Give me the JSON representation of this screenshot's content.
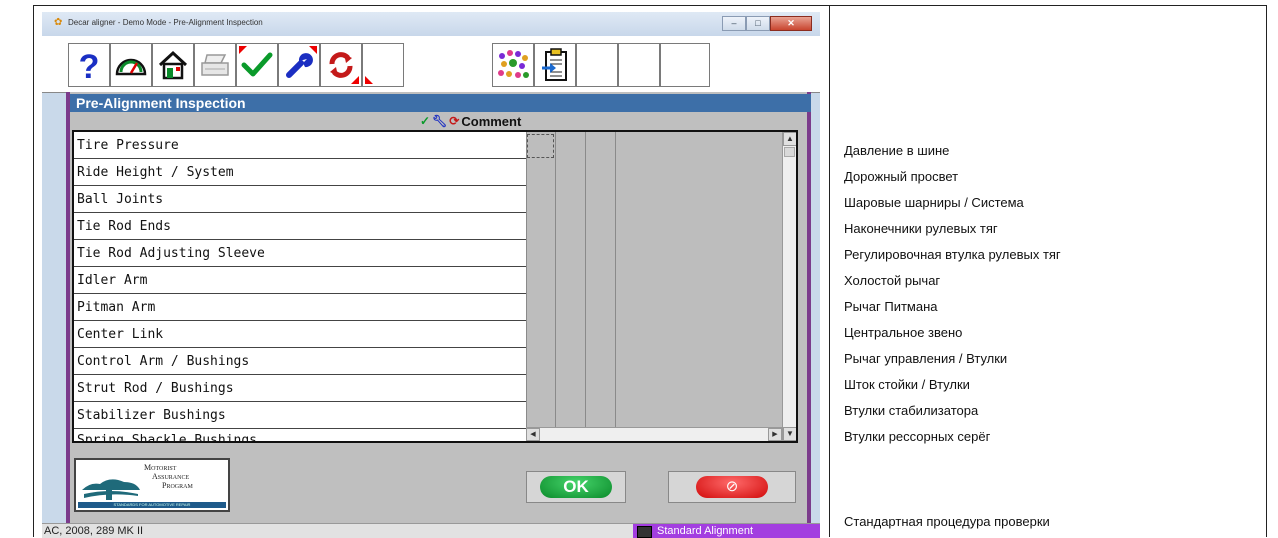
{
  "window": {
    "title": "Decar aligner - Demo Mode - Pre-Alignment Inspection",
    "controls": [
      "minimize",
      "maximize",
      "close"
    ]
  },
  "toolbar": {
    "buttons": [
      {
        "name": "help",
        "icon": "question-icon"
      },
      {
        "name": "measure",
        "icon": "gauge-icon"
      },
      {
        "name": "home",
        "icon": "home-icon"
      },
      {
        "name": "print",
        "icon": "printer-icon"
      },
      {
        "name": "check",
        "icon": "checkmark-icon"
      },
      {
        "name": "repair",
        "icon": "wrench-icon"
      },
      {
        "name": "replace",
        "icon": "cycle-arrows-icon"
      },
      {
        "name": "vehicle-spec",
        "icon": "dots-icon"
      },
      {
        "name": "report",
        "icon": "clipboard-icon"
      }
    ]
  },
  "section": {
    "title": "Pre-Alignment Inspection",
    "comment_header": "Comment"
  },
  "inspection_items": [
    "Tire Pressure",
    "Ride Height / System",
    "Ball Joints",
    "Tie Rod Ends",
    "Tie Rod Adjusting Sleeve",
    "Idler Arm",
    "Pitman Arm",
    "Center Link",
    "Control Arm / Bushings",
    "Strut Rod / Bushings",
    "Stabilizer Bushings",
    "Spring Shackle Bushings"
  ],
  "logo": {
    "line1": "Motorist",
    "line2": "Assurance",
    "line3": "Program",
    "band": "STANDARDS FOR AUTOMOTIVE REPAIR"
  },
  "buttons": {
    "ok": "OK",
    "cancel": "⊘"
  },
  "status": {
    "left": "AC, 2008, 289 MK II",
    "right": "Standard Alignment"
  },
  "translations": {
    "items": [
      "Давление в шине",
      "Дорожный просвет",
      "Шаровые шарниры / Система",
      "Наконечники рулевых тяг",
      "Регулировочная втулка рулевых тяг",
      "Холостой рычаг",
      "Рычаг Питмана",
      "Центральное звено",
      "Рычаг управления / Втулки",
      "Шток стойки / Втулки",
      "Втулки стабилизатора",
      "Втулки рессорных серёг"
    ],
    "status": "Стандартная процедура проверки"
  },
  "colors": {
    "section_header": "#3d6fa8",
    "frame_border": "#7b3b8b",
    "ok_green": "#0a8a2a",
    "cancel_red": "#d10a0a",
    "status_purple": "#a33ee0"
  }
}
